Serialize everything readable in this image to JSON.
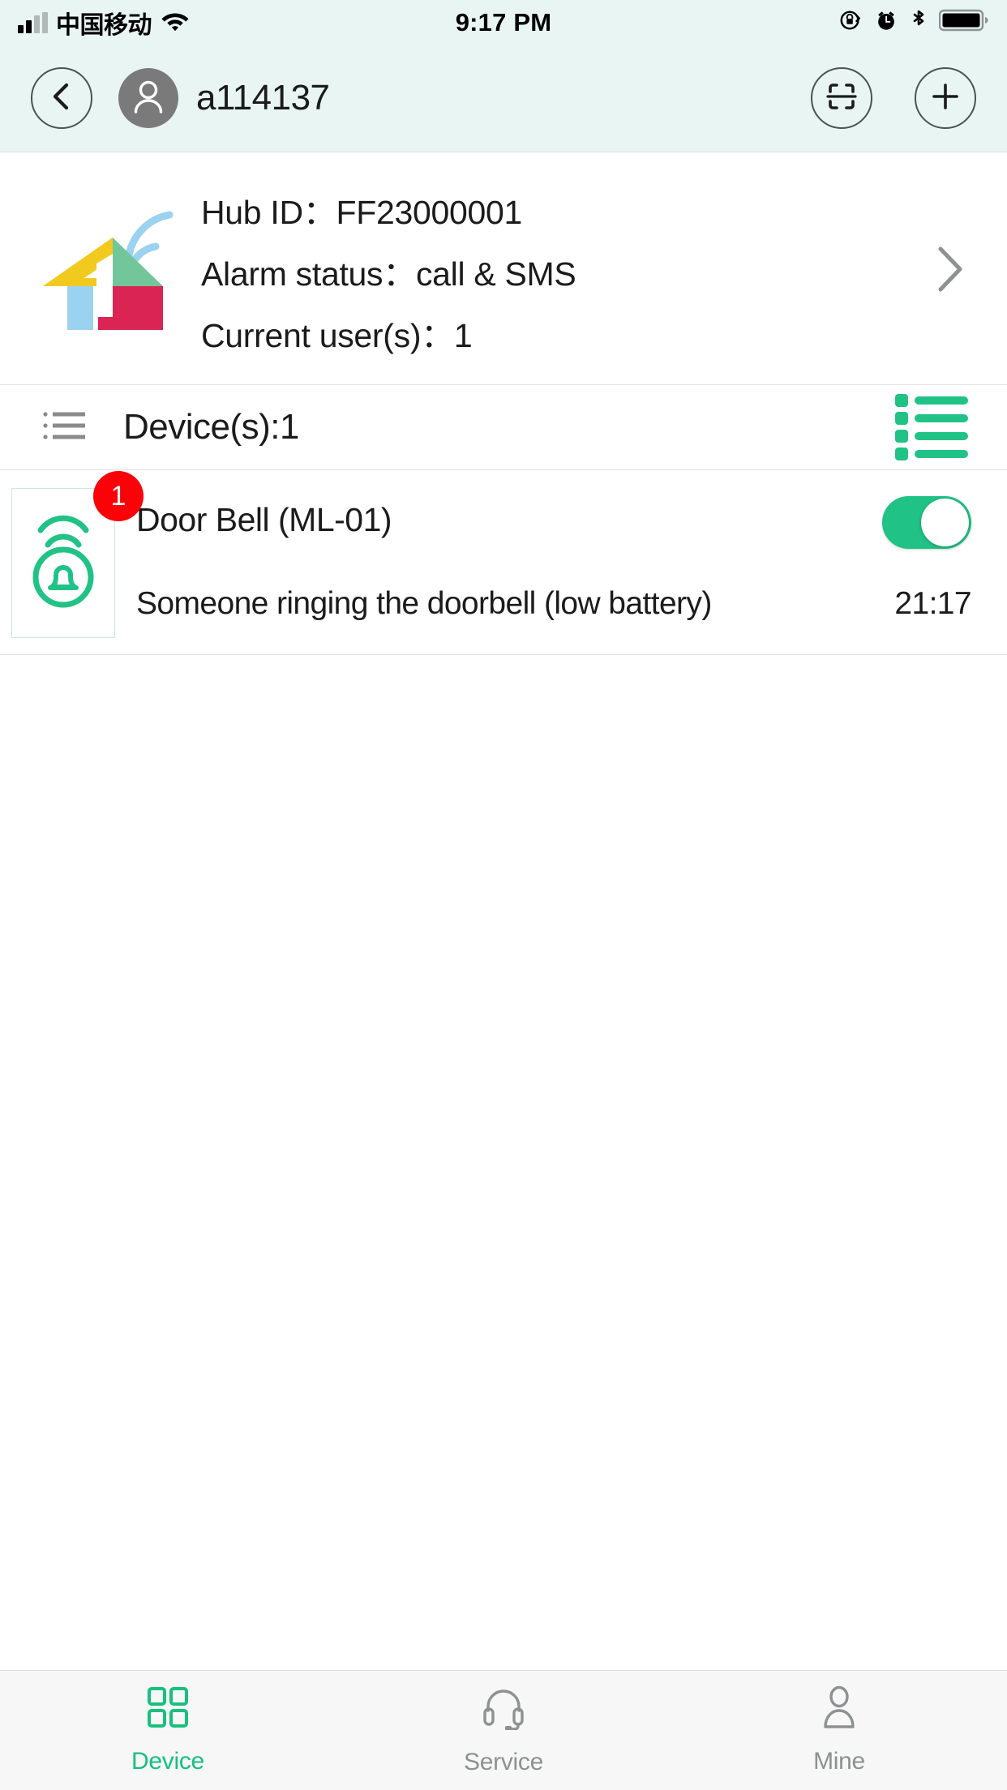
{
  "status_bar": {
    "carrier": "中国移动",
    "time": "9:17 PM",
    "icons": [
      "signal-icon",
      "wifi-icon",
      "rotation-lock-icon",
      "alarm-clock-icon",
      "bluetooth-icon",
      "battery-icon"
    ]
  },
  "nav": {
    "back_icon": "chevron-left-icon",
    "avatar_icon": "user-avatar-icon",
    "username": "a114137",
    "scan_icon": "qr-scan-icon",
    "add_icon": "plus-icon"
  },
  "hub": {
    "logo_icon": "smart-home-logo-icon",
    "hub_id_label": "Hub ID：",
    "hub_id_value": "FF23000001",
    "alarm_status_label": "Alarm status：",
    "alarm_status_value": "call & SMS",
    "current_users_label": "Current user(s)：",
    "current_users_value": "1",
    "chevron_icon": "chevron-right-icon"
  },
  "device_header": {
    "list_icon": "list-bullet-icon",
    "title": "Device(s):1",
    "view_toggle_icon": "list-view-icon"
  },
  "devices": [
    {
      "icon": "doorbell-icon",
      "badge": "1",
      "name": "Door Bell (ML-01)",
      "toggle_on": true,
      "message": "Someone ringing the doorbell (low battery)",
      "time": "21:17"
    }
  ],
  "tabs": [
    {
      "label": "Device",
      "icon": "grid-squares-icon",
      "active": true
    },
    {
      "label": "Service",
      "icon": "headset-icon",
      "active": false
    },
    {
      "label": "Mine",
      "icon": "person-icon",
      "active": false
    }
  ],
  "colors": {
    "accent_green": "#17c07d",
    "toggle_green": "#21c286",
    "badge_red": "#fa0207",
    "header_bg": "#e9f5f3",
    "tabbar_bg": "#f7f7f7",
    "inactive_gray": "#8e9191",
    "logo_yellow": "#f2ca1f",
    "logo_green": "#72c69a",
    "logo_blue": "#9ad2f0",
    "logo_crimson": "#d92454"
  }
}
